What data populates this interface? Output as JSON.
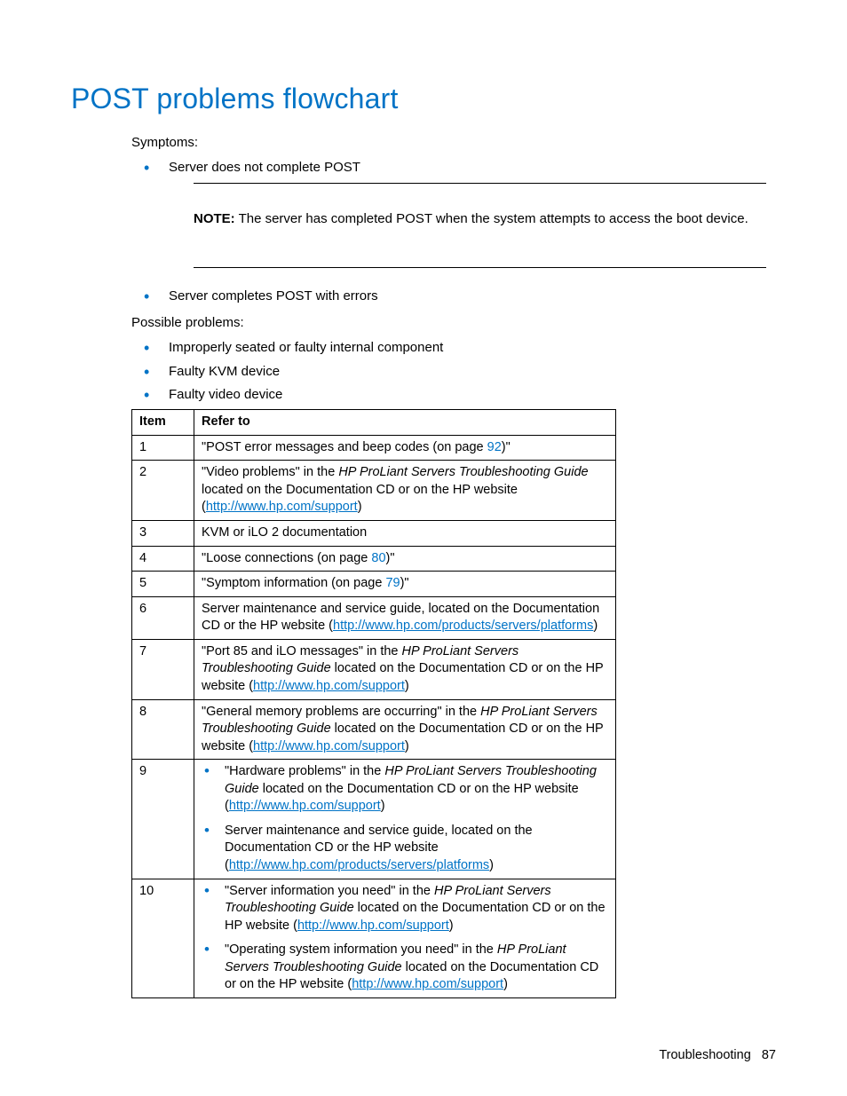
{
  "title": "POST problems flowchart",
  "symptoms_label": "Symptoms:",
  "symptoms_items": [
    "Server does not complete POST",
    "Server completes POST with errors"
  ],
  "note": {
    "label": "NOTE:",
    "text": "  The server has completed POST when the system attempts to access the boot device."
  },
  "possible_label": "Possible problems:",
  "possible_items": [
    "Improperly seated or faulty internal component",
    "Faulty KVM device",
    "Faulty video device"
  ],
  "table": {
    "headers": [
      "Item",
      "Refer to"
    ],
    "rows": [
      {
        "item": "1",
        "cell": [
          {
            "t": "text",
            "v": "\"POST error messages and beep codes (on page "
          },
          {
            "t": "pageref",
            "v": "92"
          },
          {
            "t": "text",
            "v": ")\""
          }
        ]
      },
      {
        "item": "2",
        "cell": [
          {
            "t": "text",
            "v": "\"Video problems\" in the "
          },
          {
            "t": "italic",
            "v": "HP ProLiant Servers Troubleshooting Guide"
          },
          {
            "t": "text",
            "v": " located on the Documentation CD or on the HP website ("
          },
          {
            "t": "link",
            "v": "http://www.hp.com/support"
          },
          {
            "t": "text",
            "v": ")"
          }
        ]
      },
      {
        "item": "3",
        "cell": [
          {
            "t": "text",
            "v": "KVM or iLO 2 documentation"
          }
        ]
      },
      {
        "item": "4",
        "cell": [
          {
            "t": "text",
            "v": "\"Loose connections (on page "
          },
          {
            "t": "pageref",
            "v": "80"
          },
          {
            "t": "text",
            "v": ")\""
          }
        ]
      },
      {
        "item": "5",
        "cell": [
          {
            "t": "text",
            "v": "\"Symptom information (on page "
          },
          {
            "t": "pageref",
            "v": "79"
          },
          {
            "t": "text",
            "v": ")\""
          }
        ]
      },
      {
        "item": "6",
        "cell": [
          {
            "t": "text",
            "v": "Server maintenance and service guide, located on the Documentation CD or the HP website ("
          },
          {
            "t": "link",
            "v": "http://www.hp.com/products/servers/platforms"
          },
          {
            "t": "text",
            "v": ")"
          }
        ]
      },
      {
        "item": "7",
        "cell": [
          {
            "t": "text",
            "v": "\"Port 85 and iLO messages\" in the "
          },
          {
            "t": "italic",
            "v": "HP ProLiant Servers Troubleshooting Guide"
          },
          {
            "t": "text",
            "v": " located on the Documentation CD or on the HP website ("
          },
          {
            "t": "link",
            "v": "http://www.hp.com/support"
          },
          {
            "t": "text",
            "v": ")"
          }
        ]
      },
      {
        "item": "8",
        "cell": [
          {
            "t": "text",
            "v": "\"General memory problems are occurring\" in the "
          },
          {
            "t": "italic",
            "v": "HP ProLiant Servers Troubleshooting Guide"
          },
          {
            "t": "text",
            "v": " located on the Documentation CD or on the HP website ("
          },
          {
            "t": "link",
            "v": "http://www.hp.com/support"
          },
          {
            "t": "text",
            "v": ")"
          }
        ]
      },
      {
        "item": "9",
        "list": [
          [
            {
              "t": "text",
              "v": "\"Hardware problems\" in the "
            },
            {
              "t": "italic",
              "v": "HP ProLiant Servers Troubleshooting Guide"
            },
            {
              "t": "text",
              "v": " located on the Documentation CD or on the HP website ("
            },
            {
              "t": "link",
              "v": "http://www.hp.com/support"
            },
            {
              "t": "text",
              "v": ")"
            }
          ],
          [
            {
              "t": "text",
              "v": "Server maintenance and service guide, located on the Documentation CD or the HP website ("
            },
            {
              "t": "link",
              "v": "http://www.hp.com/products/servers/platforms"
            },
            {
              "t": "text",
              "v": ")"
            }
          ]
        ]
      },
      {
        "item": "10",
        "list": [
          [
            {
              "t": "text",
              "v": "\"Server information you need\" in the "
            },
            {
              "t": "italic",
              "v": "HP ProLiant Servers Troubleshooting Guide"
            },
            {
              "t": "text",
              "v": " located on the Documentation CD or on the HP website ("
            },
            {
              "t": "link",
              "v": "http://www.hp.com/support"
            },
            {
              "t": "text",
              "v": ")"
            }
          ],
          [
            {
              "t": "text",
              "v": "\"Operating system information you need\" in the "
            },
            {
              "t": "italic",
              "v": "HP ProLiant Servers Troubleshooting Guide"
            },
            {
              "t": "text",
              "v": " located on the Documentation CD or on the HP website ("
            },
            {
              "t": "link",
              "v": "http://www.hp.com/support"
            },
            {
              "t": "text",
              "v": ")"
            }
          ]
        ]
      }
    ]
  },
  "footer": {
    "section": "Troubleshooting",
    "page": "87"
  }
}
